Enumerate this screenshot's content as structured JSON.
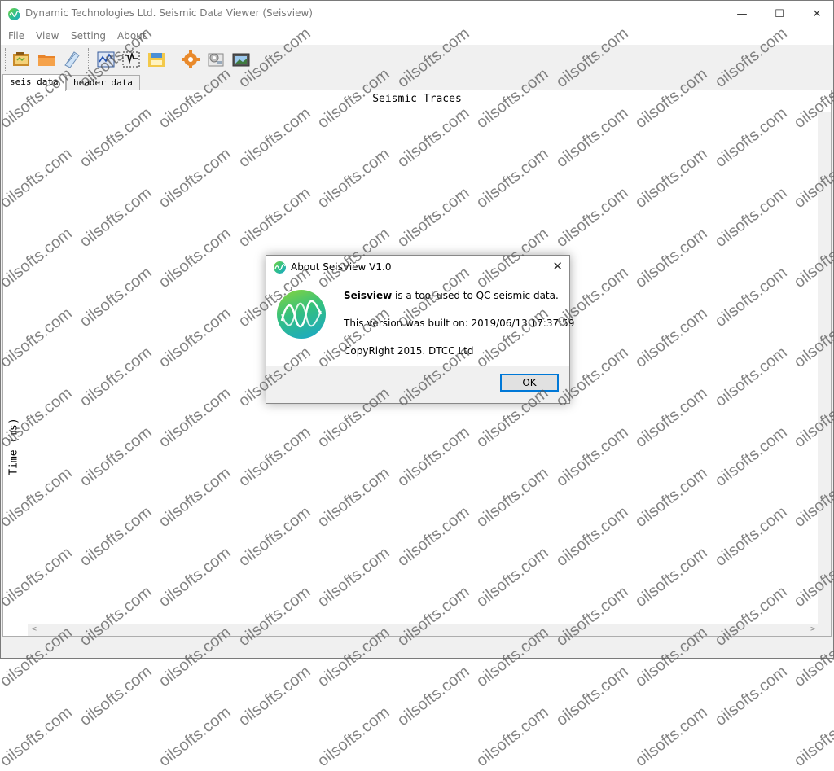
{
  "window": {
    "title": "Dynamic Technologies Ltd. Seismic Data Viewer (Seisview)",
    "minimize_glyph": "—",
    "maximize_glyph": "☐",
    "close_glyph": "✕"
  },
  "menu": {
    "items": [
      "File",
      "View",
      "Setting",
      "About"
    ]
  },
  "toolbar": {
    "buttons": [
      {
        "icon": "open-segy-icon"
      },
      {
        "icon": "folder-icon"
      },
      {
        "icon": "paper-icon"
      },
      {
        "icon": "trace-display-icon"
      },
      {
        "icon": "wiggle-icon"
      },
      {
        "icon": "save-icon"
      },
      {
        "icon": "settings-gear-icon"
      },
      {
        "icon": "config-icon"
      },
      {
        "icon": "export-image-icon"
      }
    ]
  },
  "tabs": [
    {
      "label": "seis data",
      "active": true
    },
    {
      "label": "header data",
      "active": false
    }
  ],
  "plot": {
    "title": "Seismic Traces",
    "ylabel": "Time (ms)"
  },
  "watermark": {
    "text": "oilsofts.com"
  },
  "dialog": {
    "title": "About SeisView V1.0",
    "close_glyph": "✕",
    "product_name": "Seisview",
    "line1_rest": " is a tool used to QC seismic data.",
    "line2": "This version was built on: 2019/06/13 17:37:59",
    "line3": "CopyRight 2015. DTCC Ltd",
    "ok_label": "OK"
  },
  "colors": {
    "accent": "#0078d7",
    "logo_green": "#7ad33c",
    "logo_blue": "#1aa8c8",
    "chrome_bg": "#f0f0f0"
  }
}
